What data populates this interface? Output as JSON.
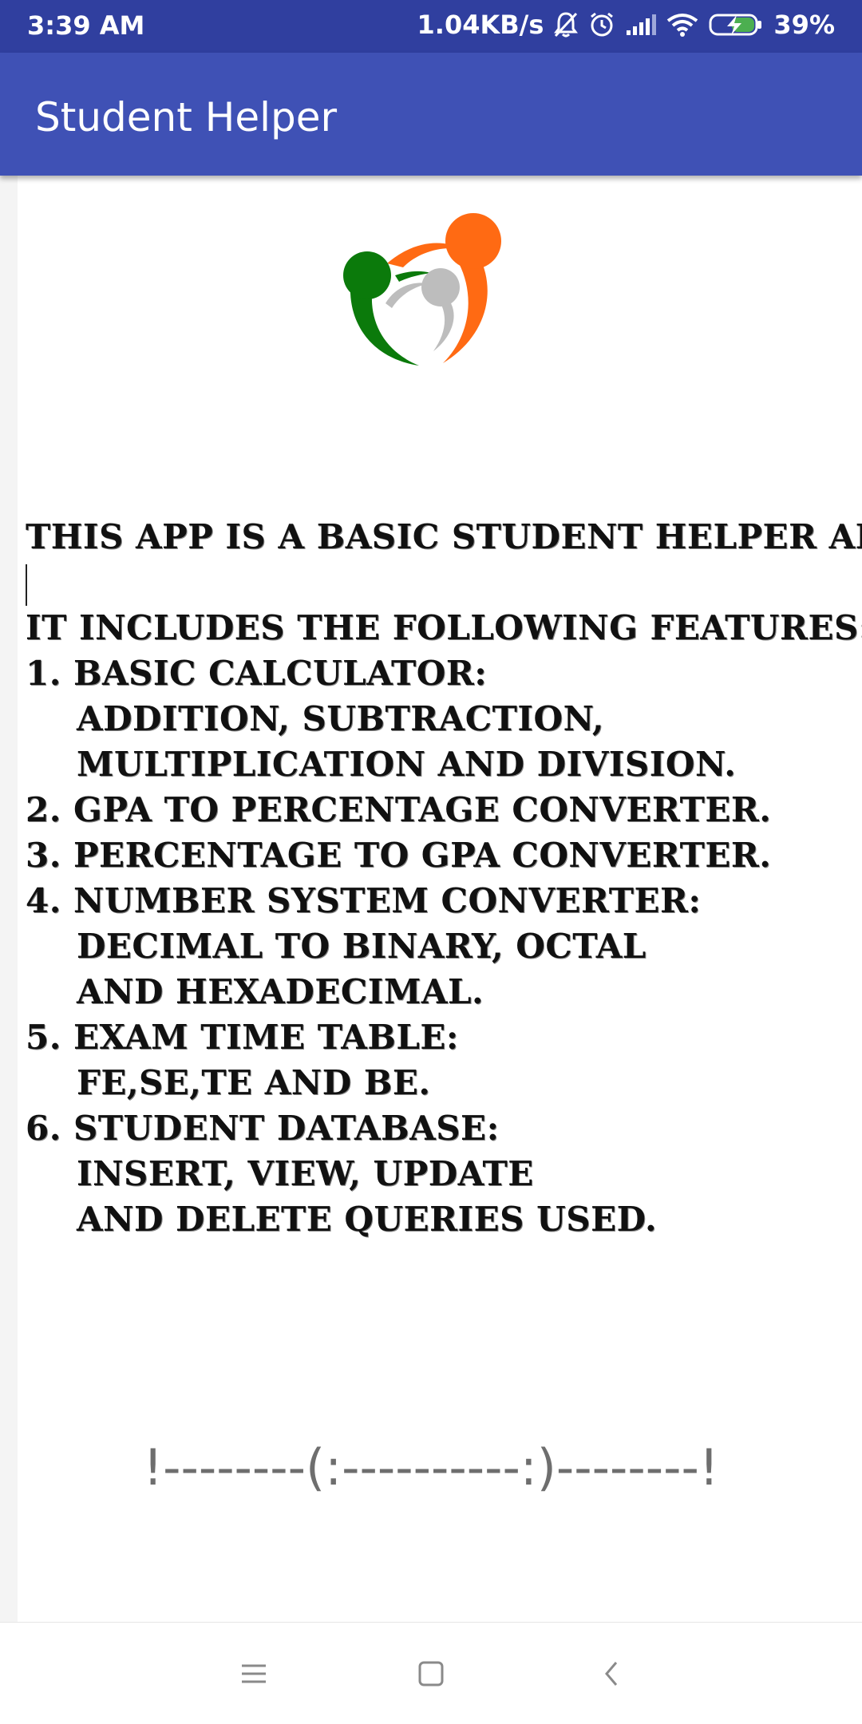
{
  "status_bar": {
    "time": "3:39 AM",
    "network_speed": "1.04KB/s",
    "battery": "39%",
    "icons": [
      "bell-off-icon",
      "alarm-icon",
      "signal-icon",
      "wifi-icon",
      "battery-charging-icon"
    ]
  },
  "app_bar": {
    "title": "Student Helper"
  },
  "logo": {
    "name": "student-helper-logo",
    "colors": {
      "orange": "#FF6A13",
      "green": "#0B7A0B",
      "gray": "#BDBDBD"
    }
  },
  "info": {
    "intro": "This app is a basic student helper app.",
    "features_heading": "It includes the following features:",
    "feature_1": "1. Basic Calculator:",
    "feature_1_detail_1": "Addition, Subtraction,",
    "feature_1_detail_2": "Multiplication and Division.",
    "feature_2": "2. GPA to Percentage Converter.",
    "feature_3": "3. Percentage to GPA Converter.",
    "feature_4": "4. Number System Converter:",
    "feature_4_detail_1": "Decimal to Binary, Octal",
    "feature_4_detail_2": "and Hexadecimal.",
    "feature_5": "5. Exam Time Table:",
    "feature_5_detail_1": "FE,SE,TE and BE.",
    "feature_6": "6. Student Database:",
    "feature_6_detail_1": "Insert, View, Update",
    "feature_6_detail_2": "and Delete Queries Used."
  },
  "footer": {
    "decoration": "!--------(:----------:)--------!"
  },
  "nav_bar": {
    "buttons": [
      "menu-icon",
      "home-icon",
      "back-icon"
    ]
  },
  "colors": {
    "status_bar": "#303F9F",
    "app_bar": "#3F51B5"
  }
}
